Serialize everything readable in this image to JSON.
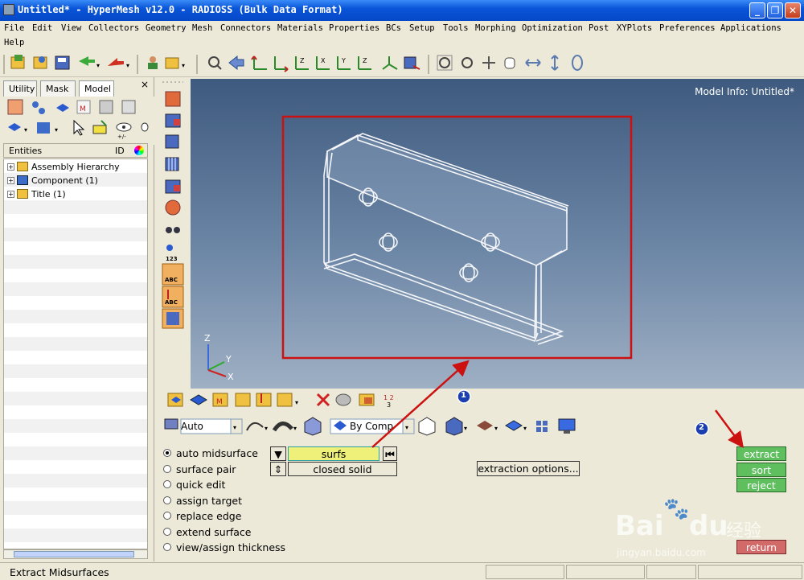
{
  "window": {
    "title": "Untitled* - HyperMesh v12.0 - RADIOSS (Bulk Data Format)",
    "minimize": "_",
    "restore": "❐",
    "close": "✕"
  },
  "menu": {
    "row1": [
      "File",
      "Edit",
      "View",
      "Collectors",
      "Geometry",
      "Mesh",
      "Connectors",
      "Materials",
      "Properties",
      "BCs",
      "Setup",
      "Tools",
      "Morphing",
      "Optimization",
      "Post",
      "XYPlots",
      "Preferences",
      "Applications"
    ],
    "row2": [
      "Help"
    ]
  },
  "left_panel": {
    "tabs": [
      "Utility",
      "Mask",
      "Model"
    ],
    "active_tab": "Model",
    "close": "×",
    "columns": {
      "entities": "Entities",
      "id": "ID"
    },
    "tree": [
      {
        "label": "Assembly Hierarchy"
      },
      {
        "label": "Component (1)"
      },
      {
        "label": "Title (1)"
      }
    ]
  },
  "viewport": {
    "model_info": "Model Info: Untitled*",
    "axes": {
      "z": "Z",
      "y": "Y",
      "x": "X"
    }
  },
  "cmd_toolbar": {
    "auto_select": "Auto",
    "by_comp": "By Comp"
  },
  "panel": {
    "options": [
      {
        "label": "auto midsurface",
        "selected": true
      },
      {
        "label": "surface pair",
        "selected": false
      },
      {
        "label": "quick edit",
        "selected": false
      },
      {
        "label": "assign target",
        "selected": false
      },
      {
        "label": "replace edge",
        "selected": false
      },
      {
        "label": "extend surface",
        "selected": false
      },
      {
        "label": "view/assign thickness",
        "selected": false
      }
    ],
    "entity_selector": "surfs",
    "mode_selector": "closed solid",
    "extraction_options": "extraction options...",
    "actions": {
      "extract": "extract",
      "sort": "sort",
      "reject": "reject",
      "return": "return"
    }
  },
  "annotations": {
    "marker1": "1",
    "marker2": "2"
  },
  "status": {
    "message": "Extract Midsurfaces"
  },
  "watermark": {
    "brand": "Bai",
    "brand2": "du",
    "cn": "经验",
    "url": "jingyan.baidu.com"
  },
  "colors": {
    "accent_green": "#5fbf5f",
    "return_red": "#d36a6a",
    "highlight_yellow": "#eef07a",
    "annotation_red": "#cc1111",
    "marker_blue": "#1c3fb0"
  }
}
